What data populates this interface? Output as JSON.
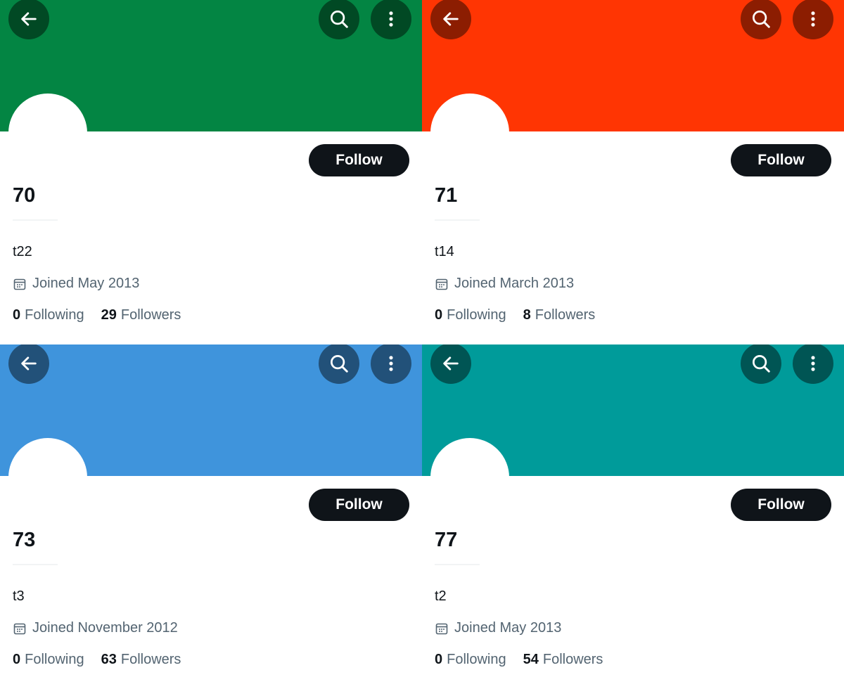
{
  "profiles": [
    {
      "banner_color": "#038543",
      "display_name": "70",
      "bio": "t22",
      "joined": "Joined May 2013",
      "following_count": "0",
      "following_label": "Following",
      "followers_count": "29",
      "followers_label": "Followers",
      "follow_label": "Follow",
      "icons": {
        "back": "arrow-left-icon",
        "search": "search-icon",
        "more": "more-vertical-icon",
        "calendar": "calendar-icon"
      }
    },
    {
      "banner_color": "#ff3503",
      "display_name": "71",
      "bio": "t14",
      "joined": "Joined March 2013",
      "following_count": "0",
      "following_label": "Following",
      "followers_count": "8",
      "followers_label": "Followers",
      "follow_label": "Follow",
      "icons": {
        "back": "arrow-left-icon",
        "search": "search-icon",
        "more": "more-vertical-icon",
        "calendar": "calendar-icon"
      }
    },
    {
      "banner_color": "#3f94dc",
      "display_name": "73",
      "bio": "t3",
      "joined": "Joined November 2012",
      "following_count": "0",
      "following_label": "Following",
      "followers_count": "63",
      "followers_label": "Followers",
      "follow_label": "Follow",
      "icons": {
        "back": "arrow-left-icon",
        "search": "search-icon",
        "more": "more-vertical-icon",
        "calendar": "calendar-icon"
      }
    },
    {
      "banner_color": "#009b9a",
      "display_name": "77",
      "bio": "t2",
      "joined": "Joined May 2013",
      "following_count": "0",
      "following_label": "Following",
      "followers_count": "54",
      "followers_label": "Followers",
      "follow_label": "Follow",
      "icons": {
        "back": "arrow-left-icon",
        "search": "search-icon",
        "more": "more-vertical-icon",
        "calendar": "calendar-icon"
      }
    }
  ]
}
